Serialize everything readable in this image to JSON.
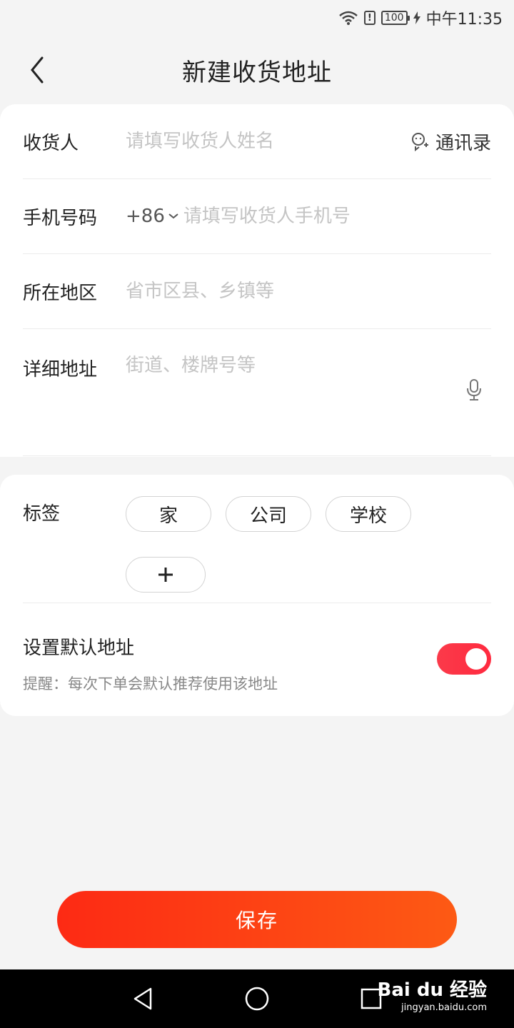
{
  "status_bar": {
    "alert": "!",
    "battery": "100",
    "time": "中午11:35"
  },
  "header": {
    "title": "新建收货地址"
  },
  "form": {
    "recipient": {
      "label": "收货人",
      "placeholder": "请填写收货人姓名",
      "contacts_label": "通讯录"
    },
    "phone": {
      "label": "手机号码",
      "country_code": "+86",
      "placeholder": "请填写收货人手机号"
    },
    "region": {
      "label": "所在地区",
      "placeholder": "省市区县、乡镇等"
    },
    "address": {
      "label": "详细地址",
      "placeholder": "街道、楼牌号等"
    }
  },
  "tags": {
    "label": "标签",
    "items": [
      {
        "label": "家"
      },
      {
        "label": "公司"
      },
      {
        "label": "学校"
      }
    ],
    "add_label": "+"
  },
  "default_address": {
    "title": "设置默认地址",
    "hint": "提醒：每次下单会默认推荐使用该地址",
    "enabled": true
  },
  "save_label": "保存",
  "watermark": {
    "logo": "Bai du 经验",
    "url": "jingyan.baidu.com"
  },
  "colors": {
    "accent": "#fd2a14",
    "toggle_on": "#fb3a4a",
    "placeholder": "#c4c4c4",
    "background": "#f4f4f4"
  }
}
